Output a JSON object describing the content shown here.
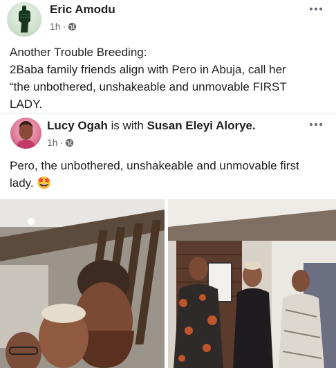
{
  "post": {
    "author": "Eric Amodu",
    "time": "1h",
    "separator": "·",
    "body_lines": [
      "Another Trouble Breeding:",
      "2Baba family friends align with Pero in Abuja, call her",
      "“the unbothered, unshakeable and unmovable FIRST",
      "LADY."
    ]
  },
  "shared": {
    "author": "Lucy Ogah",
    "is_with": "is with",
    "tagged": "Susan Eleyi Alorye.",
    "time": "1h",
    "separator": "·",
    "body_lines": [
      "Pero, the unbothered, unshakeable and unmovable first",
      "lady. 🤩"
    ]
  },
  "icons": {
    "globe": "globe-icon",
    "more": "more-options-icon"
  },
  "colors": {
    "text": "#1c1e21",
    "meta": "#65676b"
  }
}
